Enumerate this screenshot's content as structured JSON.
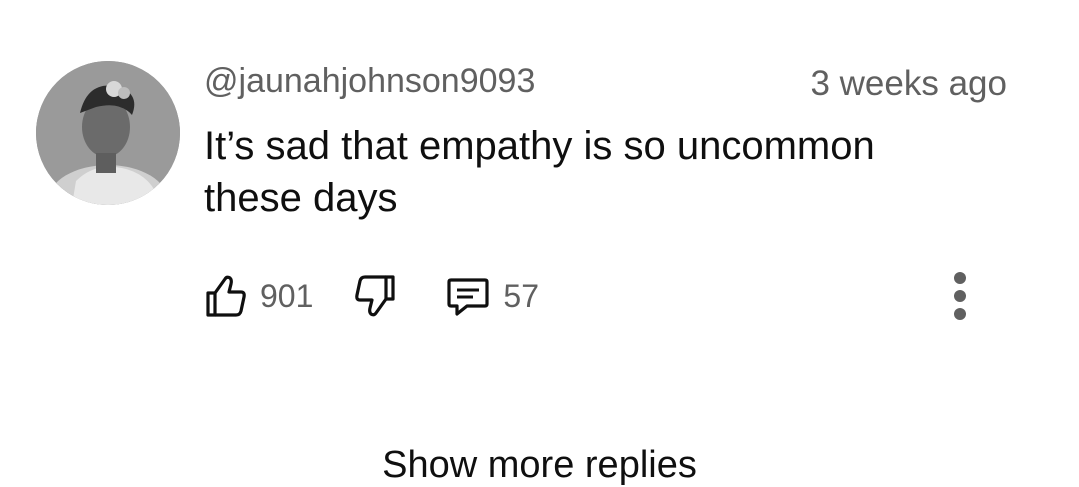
{
  "comment": {
    "author": "@jaunahjohnson9093",
    "timestamp": "3 weeks ago",
    "text": "It’s sad that empathy is so uncommon these days",
    "likes": "901",
    "replies": "57"
  },
  "icons": {
    "like": "thumbs-up-icon",
    "dislike": "thumbs-down-icon",
    "reply": "comment-icon",
    "more": "vertical-dots-icon"
  },
  "colors": {
    "primary_text": "#0f0f0f",
    "secondary_text": "#606060"
  },
  "footer": {
    "show_more_label": "Show more replies"
  }
}
